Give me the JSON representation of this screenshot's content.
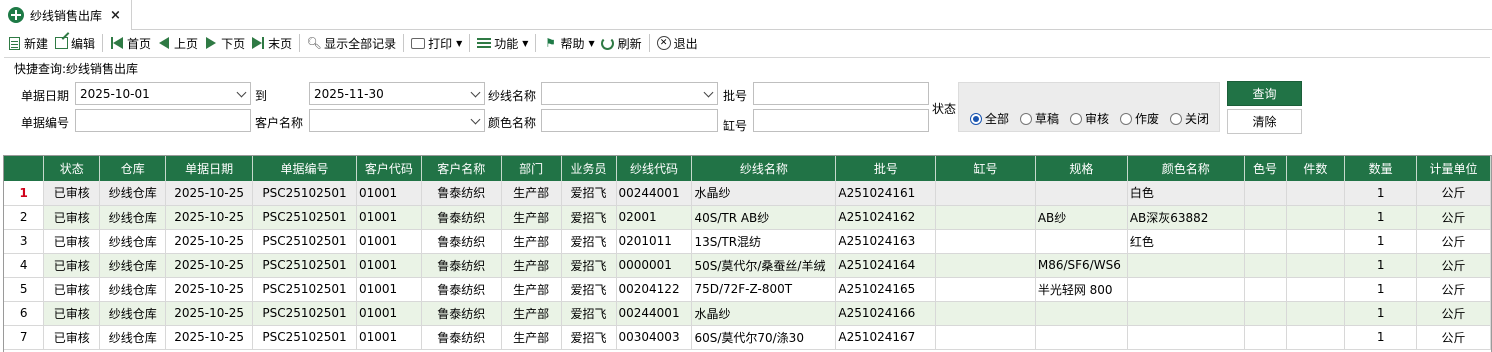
{
  "tab": {
    "title": "纱线销售出库",
    "close": "×"
  },
  "toolbar": {
    "new": "新建",
    "edit": "编辑",
    "first": "首页",
    "prev": "上页",
    "next": "下页",
    "last": "末页",
    "show_all": "显示全部记录",
    "print": "打印",
    "function": "功能",
    "help": "帮助",
    "refresh": "刷新",
    "exit": "退出"
  },
  "query": {
    "title": "快捷查询:纱线销售出库",
    "date_label": "单据日期",
    "date_from": "2025-10-01",
    "to_label": "到",
    "date_to": "2025-11-30",
    "yarn_name_label": "纱线名称",
    "yarn_name": "",
    "batch_label": "批号",
    "batch": "",
    "doc_no_label": "单据编号",
    "doc_no": "",
    "customer_label": "客户名称",
    "customer": "",
    "color_label": "颜色名称",
    "color": "",
    "vat_label": "缸号",
    "vat": "",
    "status_label": "状态",
    "status_options": [
      "全部",
      "草稿",
      "审核",
      "作废",
      "关闭"
    ],
    "status_selected": "全部",
    "query_button": "查询",
    "clear_button": "清除"
  },
  "grid": {
    "columns": [
      "",
      "状态",
      "仓库",
      "单据日期",
      "单据编号",
      "客户代码",
      "客户名称",
      "部门",
      "业务员",
      "纱线代码",
      "纱线名称",
      "批号",
      "缸号",
      "规格",
      "颜色名称",
      "色号",
      "件数",
      "数量",
      "计量单位"
    ],
    "rows": [
      [
        "1",
        "已审核",
        "纱线仓库",
        "2025-10-25",
        "PSC25102501",
        "01001",
        "鲁泰纺织",
        "生产部",
        "爱招飞",
        "00244001",
        "水晶纱",
        "A251024161",
        "",
        "",
        "白色",
        "",
        "",
        "1",
        "公斤"
      ],
      [
        "2",
        "已审核",
        "纱线仓库",
        "2025-10-25",
        "PSC25102501",
        "01001",
        "鲁泰纺织",
        "生产部",
        "爱招飞",
        "02001",
        "40S/TR AB纱",
        "A251024162",
        "",
        "AB纱",
        "AB深灰63882",
        "",
        "",
        "1",
        "公斤"
      ],
      [
        "3",
        "已审核",
        "纱线仓库",
        "2025-10-25",
        "PSC25102501",
        "01001",
        "鲁泰纺织",
        "生产部",
        "爱招飞",
        "0201011",
        "13S/TR混纺",
        "A251024163",
        "",
        "",
        "红色",
        "",
        "",
        "1",
        "公斤"
      ],
      [
        "4",
        "已审核",
        "纱线仓库",
        "2025-10-25",
        "PSC25102501",
        "01001",
        "鲁泰纺织",
        "生产部",
        "爱招飞",
        "0000001",
        "50S/莫代尔/桑蚕丝/羊绒",
        "A251024164",
        "",
        "M86/SF6/WS6",
        "",
        "",
        "",
        "1",
        "公斤"
      ],
      [
        "5",
        "已审核",
        "纱线仓库",
        "2025-10-25",
        "PSC25102501",
        "01001",
        "鲁泰纺织",
        "生产部",
        "爱招飞",
        "00204122",
        "75D/72F-Z-800T",
        "A251024165",
        "",
        "半光轻网  800",
        "",
        "",
        "",
        "1",
        "公斤"
      ],
      [
        "6",
        "已审核",
        "纱线仓库",
        "2025-10-25",
        "PSC25102501",
        "01001",
        "鲁泰纺织",
        "生产部",
        "爱招飞",
        "00244001",
        "水晶纱",
        "A251024166",
        "",
        "",
        "",
        "",
        "",
        "1",
        "公斤"
      ],
      [
        "7",
        "已审核",
        "纱线仓库",
        "2025-10-25",
        "PSC25102501",
        "01001",
        "鲁泰纺织",
        "生产部",
        "爱招飞",
        "00304003",
        "60S/莫代尔70/涤30",
        "A251024167",
        "",
        "",
        "",
        "",
        "",
        "1",
        "公斤"
      ]
    ]
  }
}
